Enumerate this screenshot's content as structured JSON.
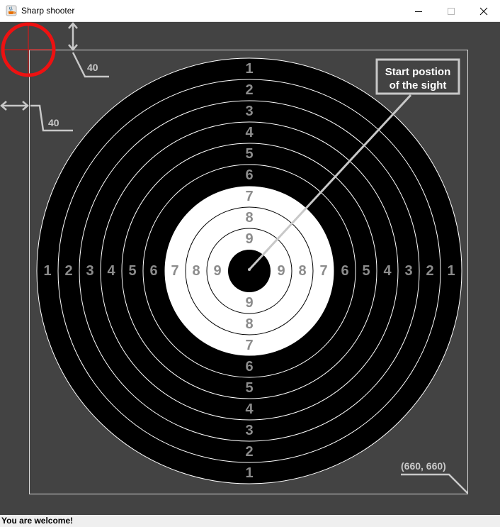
{
  "window": {
    "title": "Sharp shooter",
    "icon": "java-cup-icon",
    "controls": [
      "minimize-icon",
      "maximize-icon",
      "close-icon"
    ]
  },
  "target": {
    "rings_outer_to_inner": [
      "1",
      "2",
      "3",
      "4",
      "5",
      "6",
      "7",
      "8",
      "9"
    ],
    "ring_colors": {
      "outer": "#000000",
      "inner": "#ffffff",
      "bull": "#000000",
      "numbers": "#8c8c8c"
    }
  },
  "annotations": {
    "offset_top": "40",
    "offset_left": "40",
    "corner_label": "(660, 660)",
    "callout_line1": "Start postion",
    "callout_line2": "of the sight"
  },
  "sight": {
    "color": "#ee1111"
  },
  "status": {
    "text": "You are welcome!"
  },
  "colors": {
    "canvas_bg": "#434343",
    "annotation": "#c8c8c8"
  }
}
